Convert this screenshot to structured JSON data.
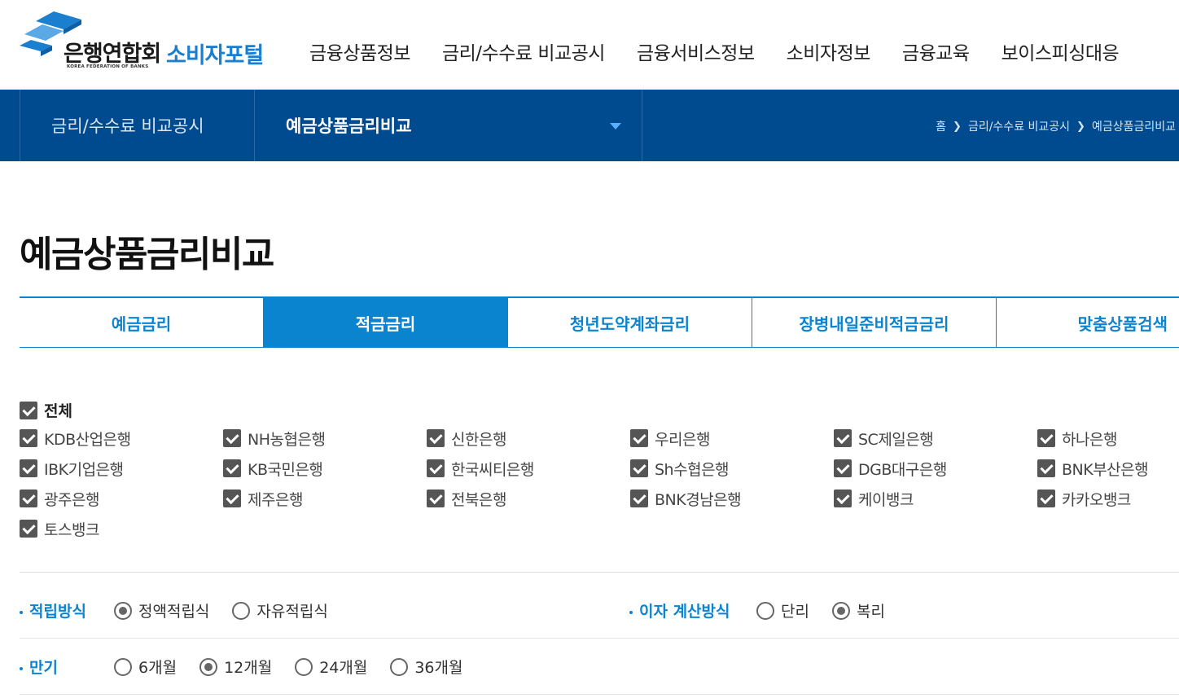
{
  "header": {
    "logo_main": "은행연합회",
    "logo_sub": "KOREA FEDERATION OF BANKS",
    "logo_portal": "소비자포털",
    "gnb": [
      "금융상품정보",
      "금리/수수료 비교공시",
      "금융서비스정보",
      "소비자정보",
      "금융교육",
      "보이스피싱대응"
    ]
  },
  "subnav": {
    "section": "금리/수수료 비교공시",
    "current": "예금상품금리비교",
    "breadcrumb": [
      "홈",
      "금리/수수료 비교공시",
      "예금상품금리비교"
    ]
  },
  "page_title": "예금상품금리비교",
  "tabs": [
    {
      "label": "예금금리",
      "active": false
    },
    {
      "label": "적금금리",
      "active": true
    },
    {
      "label": "청년도약계좌금리",
      "active": false
    },
    {
      "label": "장병내일준비적금금리",
      "active": false
    },
    {
      "label": "맞춤상품검색",
      "active": false
    }
  ],
  "check_all_label": "전체",
  "banks": [
    "KDB산업은행",
    "NH농협은행",
    "신한은행",
    "우리은행",
    "SC제일은행",
    "하나은행",
    "IBK기업은행",
    "KB국민은행",
    "한국씨티은행",
    "Sh수협은행",
    "DGB대구은행",
    "BNK부산은행",
    "광주은행",
    "제주은행",
    "전북은행",
    "BNK경남은행",
    "케이뱅크",
    "카카오뱅크",
    "토스뱅크"
  ],
  "savings_method": {
    "label": "적립방식",
    "options": [
      "정액적립식",
      "자유적립식"
    ],
    "selected": "정액적립식"
  },
  "interest_method": {
    "label": "이자 계산방식",
    "options": [
      "단리",
      "복리"
    ],
    "selected": "복리"
  },
  "term": {
    "label": "만기",
    "options": [
      "6개월",
      "12개월",
      "24개월",
      "36개월"
    ],
    "selected": "12개월"
  },
  "colors": {
    "primary": "#0b84cf",
    "navy": "#004a8f",
    "portal_blue": "#1b7fd0"
  }
}
